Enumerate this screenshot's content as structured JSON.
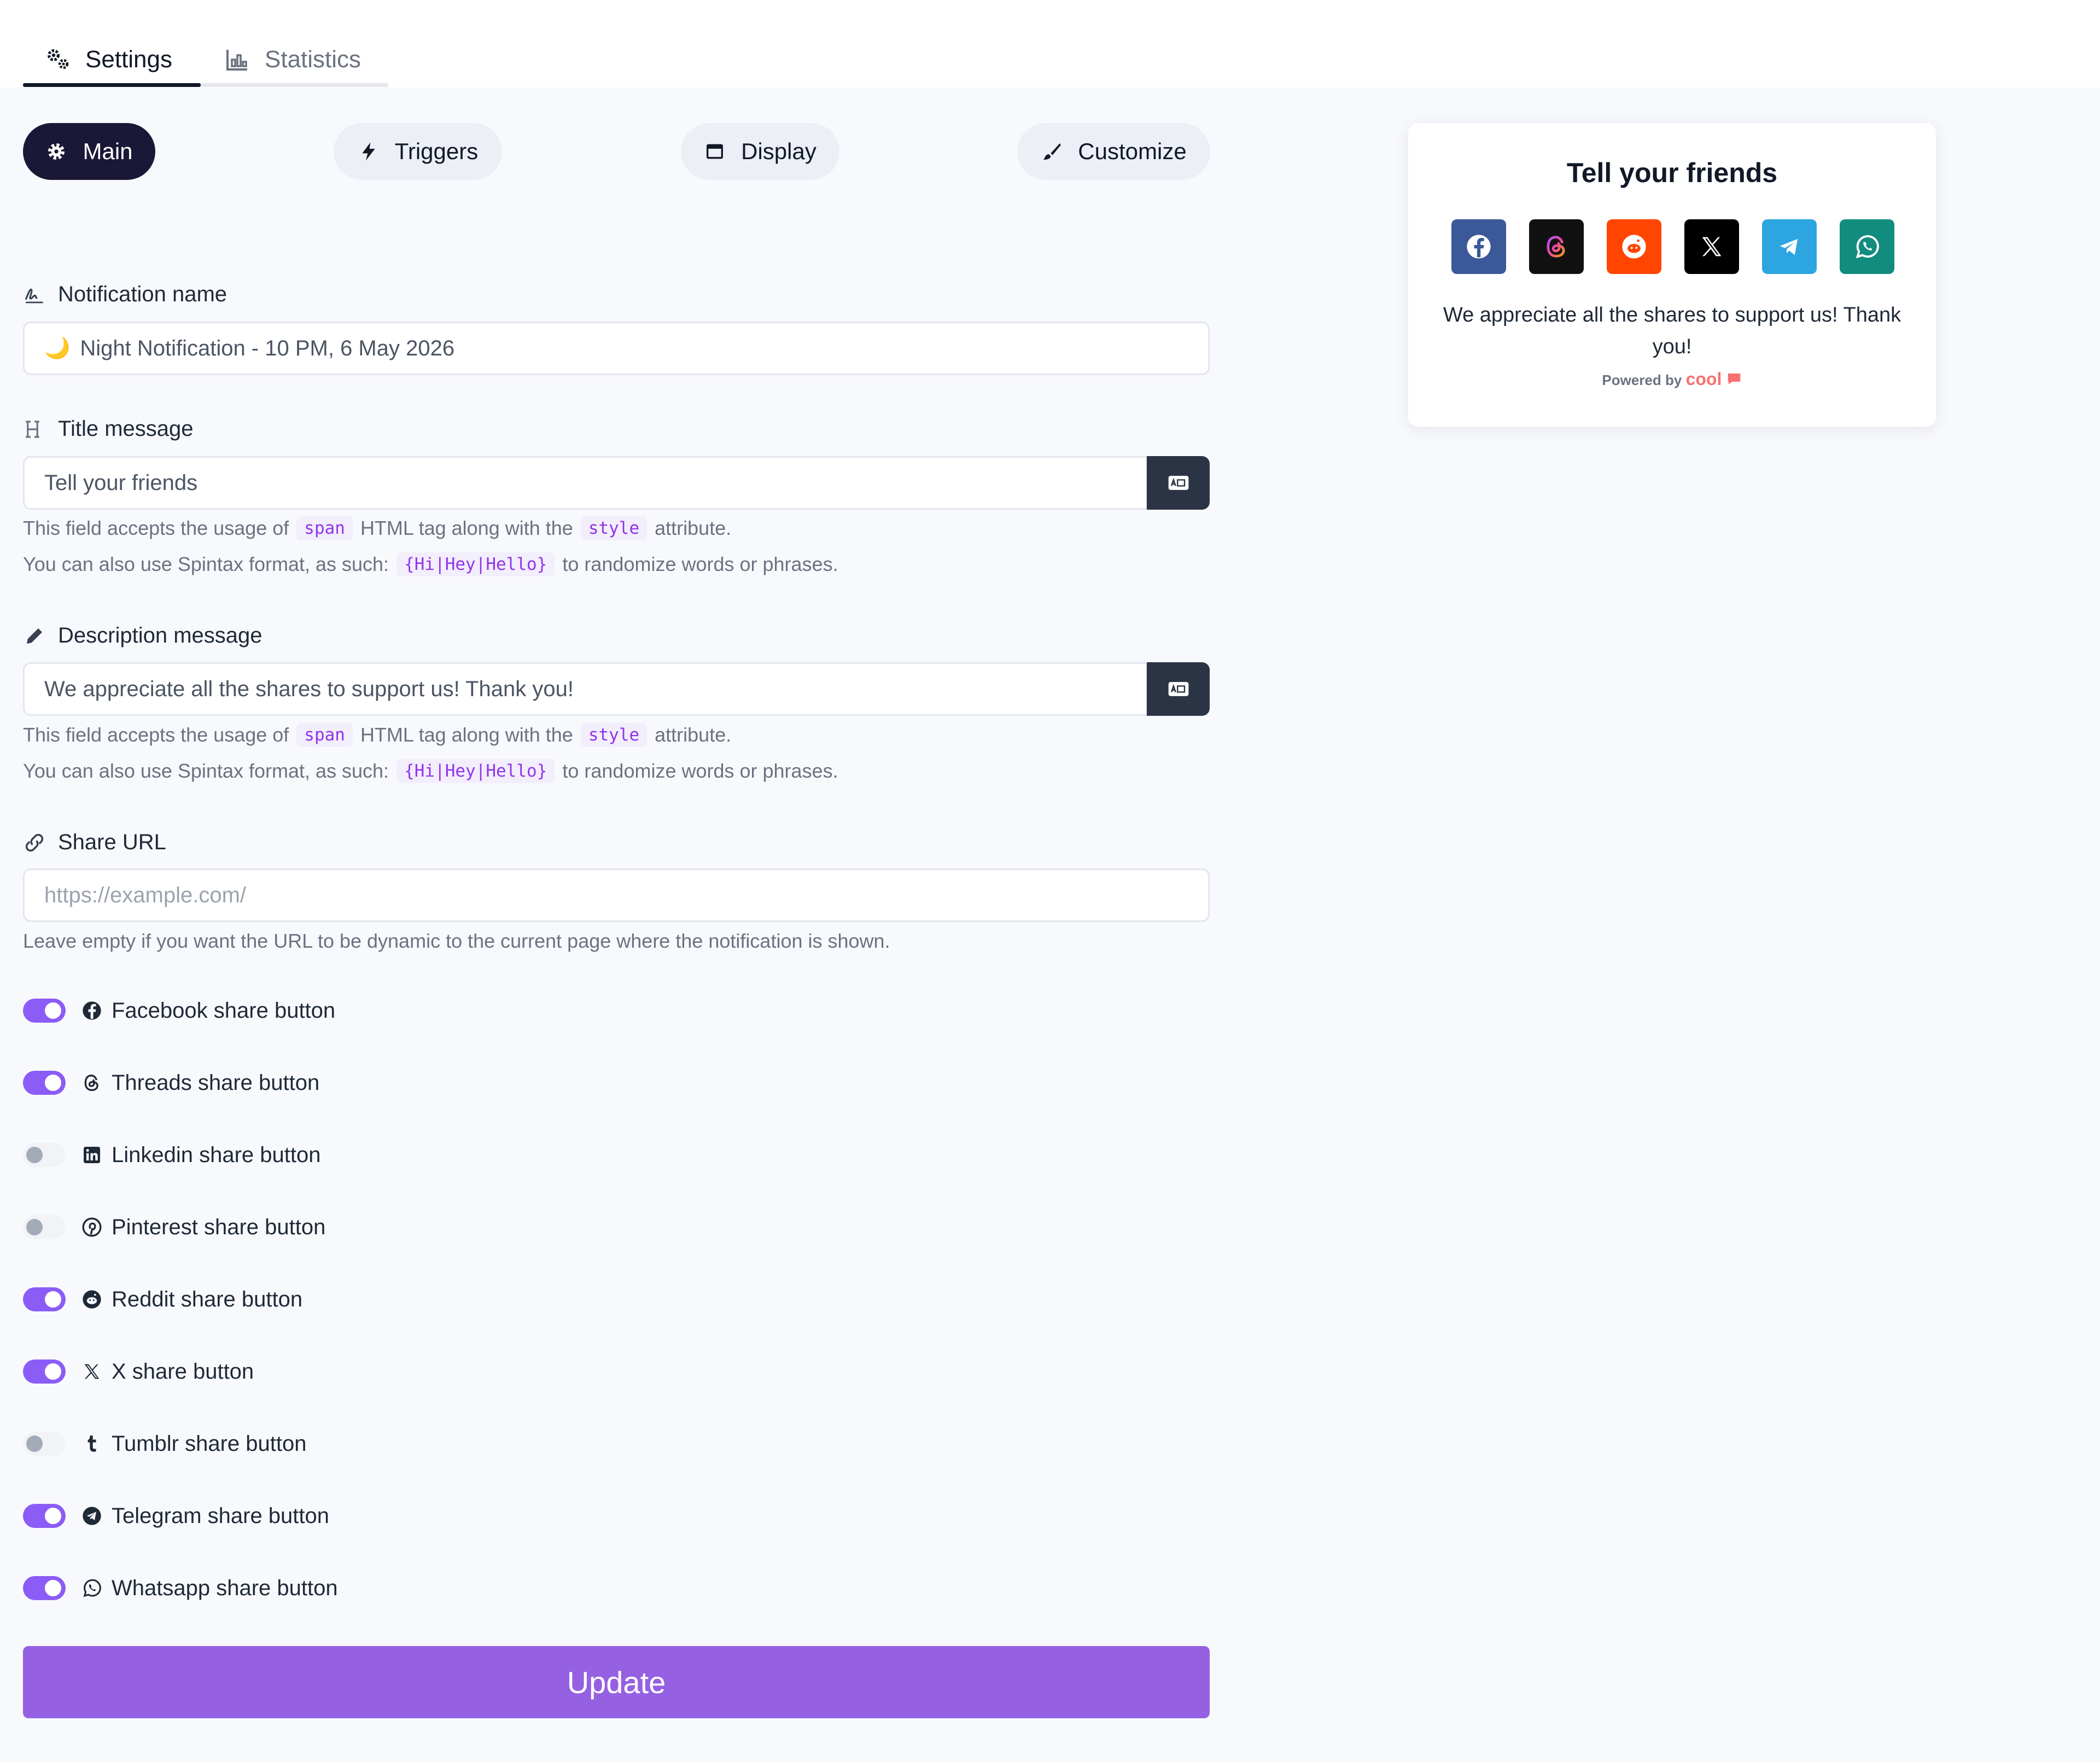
{
  "tabs": [
    {
      "label": "Settings",
      "icon": "gears-icon",
      "active": true
    },
    {
      "label": "Statistics",
      "icon": "bar-chart-icon",
      "active": false
    }
  ],
  "pills": [
    {
      "label": "Main",
      "icon": "cog-icon",
      "active": true
    },
    {
      "label": "Triggers",
      "icon": "bolt-icon",
      "active": false
    },
    {
      "label": "Display",
      "icon": "window-icon",
      "active": false
    },
    {
      "label": "Customize",
      "icon": "paintbrush-icon",
      "active": false
    }
  ],
  "form": {
    "notification_name": {
      "label": "Notification name",
      "icon": "signature-icon",
      "value": "Night Notification - 10 PM, 6 May 2026",
      "emoji": "🌙"
    },
    "title_message": {
      "label": "Title message",
      "icon": "heading-icon",
      "value": "Tell your friends",
      "help1_pre": "This field accepts the usage of",
      "help1_code1": "span",
      "help1_mid": "HTML tag along with the",
      "help1_code2": "style",
      "help1_post": "attribute.",
      "help2_pre": "You can also use Spintax format, as such:",
      "help2_code": "{Hi|Hey|Hello}",
      "help2_post": "to randomize words or phrases."
    },
    "description_message": {
      "label": "Description message",
      "icon": "pencil-icon",
      "value": "We appreciate all the shares to support us! Thank you!",
      "help1_pre": "This field accepts the usage of",
      "help1_code1": "span",
      "help1_mid": "HTML tag along with the",
      "help1_code2": "style",
      "help1_post": "attribute.",
      "help2_pre": "You can also use Spintax format, as such:",
      "help2_code": "{Hi|Hey|Hello}",
      "help2_post": "to randomize words or phrases."
    },
    "share_url": {
      "label": "Share URL",
      "icon": "link-icon",
      "value": "",
      "placeholder": "https://example.com/",
      "help": "Leave empty if you want the URL to be dynamic to the current page where the notification is shown."
    }
  },
  "toggles": [
    {
      "label": "Facebook share button",
      "on": true,
      "icon": "facebook-icon"
    },
    {
      "label": "Threads share button",
      "on": true,
      "icon": "threads-icon"
    },
    {
      "label": "Linkedin share button",
      "on": false,
      "icon": "linkedin-icon"
    },
    {
      "label": "Pinterest share button",
      "on": false,
      "icon": "pinterest-icon"
    },
    {
      "label": "Reddit share button",
      "on": true,
      "icon": "reddit-icon"
    },
    {
      "label": "X share button",
      "on": true,
      "icon": "x-icon"
    },
    {
      "label": "Tumblr share button",
      "on": false,
      "icon": "tumblr-icon"
    },
    {
      "label": "Telegram share button",
      "on": true,
      "icon": "telegram-icon"
    },
    {
      "label": "Whatsapp share button",
      "on": true,
      "icon": "whatsapp-icon"
    }
  ],
  "update_label": "Update",
  "preview": {
    "title": "Tell your friends",
    "description": "We appreciate all the shares to support us! Thank you!",
    "powered_by": "Powered by",
    "brand": "cool",
    "share_icons": [
      {
        "icon": "facebook-icon",
        "color": "#3b5998"
      },
      {
        "icon": "threads-icon",
        "color": "#000000"
      },
      {
        "icon": "reddit-icon",
        "color": "#ff4500"
      },
      {
        "icon": "x-icon",
        "color": "#000000"
      },
      {
        "icon": "telegram-icon",
        "color": "#2ca5e0"
      },
      {
        "icon": "whatsapp-icon",
        "color": "#128c7e"
      }
    ]
  },
  "colors": {
    "accent": "#9561e2",
    "toggle_on": "#8b5cf6",
    "dark_pill": "#1a1836"
  }
}
